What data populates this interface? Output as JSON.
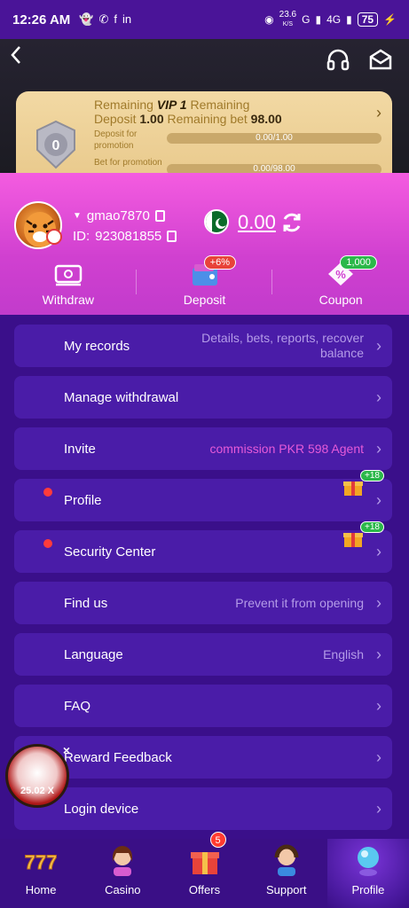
{
  "status_bar": {
    "time": "12:26 AM",
    "net_speed": "23.6",
    "net_unit": "K/S",
    "signal1": "G",
    "signal2": "4G",
    "battery": "75"
  },
  "header": {
    "back_icon": "back-chevron-icon",
    "support_icon": "headset-icon",
    "mail_icon": "mail-icon"
  },
  "vip": {
    "level": "0",
    "line1_prefix": "Remaining",
    "vip_name": "VIP 1",
    "line1_suffix": "Remaining",
    "deposit_label": "Deposit",
    "deposit_value": "1.00",
    "bet_label": "Remaining bet",
    "bet_value": "98.00",
    "deposit_promo_label": "Deposit for promotion",
    "deposit_promo_value": "0.00/1.00",
    "bet_promo_label": "Bet for promotion",
    "bet_promo_value": "0.00/98.00"
  },
  "user": {
    "username": "gmao7870",
    "id_label": "ID:",
    "id": "923081855",
    "balance": "0.00"
  },
  "actions": [
    {
      "label": "Withdraw",
      "icon": "wallet-card-icon"
    },
    {
      "label": "Deposit",
      "icon": "deposit-wallet-icon",
      "tag": "+6%"
    },
    {
      "label": "Coupon",
      "icon": "coupon-icon",
      "tag": "1,000"
    }
  ],
  "menu": [
    {
      "label": "My records",
      "value": "Details, bets, reports, recover balance"
    },
    {
      "label": "Manage withdrawal",
      "value": ""
    },
    {
      "label": "Invite",
      "value": "commission PKR 598  Agent"
    },
    {
      "label": "Profile",
      "value": "",
      "badge": "+18",
      "dot": true
    },
    {
      "label": "Security Center",
      "value": "",
      "badge": "+18",
      "dot": true
    },
    {
      "label": "Find us",
      "value": "Prevent it from opening"
    },
    {
      "label": "Language",
      "value": "English"
    },
    {
      "label": "FAQ",
      "value": ""
    },
    {
      "label": "Reward Feedback",
      "value": ""
    },
    {
      "label": "Login device",
      "value": ""
    }
  ],
  "floating_widget": {
    "multiplier": "25.02 X",
    "close": "×"
  },
  "nav": [
    {
      "label": "Home",
      "icon": "slot-777-icon"
    },
    {
      "label": "Casino",
      "icon": "casino-girl-icon"
    },
    {
      "label": "Offers",
      "icon": "gift-offers-icon",
      "badge": "5"
    },
    {
      "label": "Support",
      "icon": "support-agent-icon"
    },
    {
      "label": "Profile",
      "icon": "profile-orb-icon",
      "active": true
    }
  ],
  "colors": {
    "accent_pink": "#f45ce0",
    "menu_bg": "#4a1ca8",
    "page_bg": "#3a0f8a",
    "gold": "#e8c88a"
  }
}
